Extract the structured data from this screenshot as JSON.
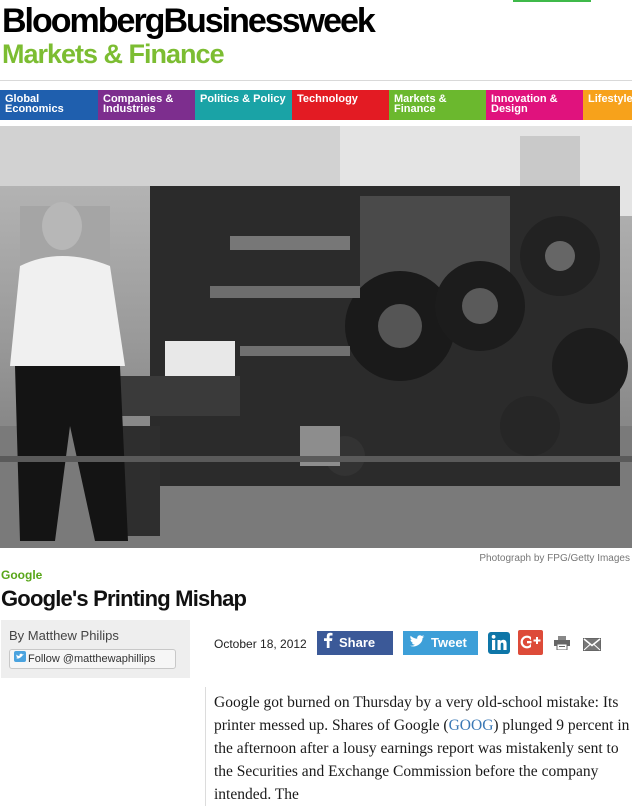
{
  "masthead": {
    "brand": "BloombergBusinessweek",
    "section": "Markets & Finance"
  },
  "nav": {
    "items": [
      {
        "label": "Global Economics",
        "color": "#1f5fae"
      },
      {
        "label": "Companies & Industries",
        "color": "#7d2e8e"
      },
      {
        "label": "Politics & Policy",
        "color": "#1aa3a6"
      },
      {
        "label": "Technology",
        "color": "#e31b23"
      },
      {
        "label": "Markets & Finance",
        "color": "#6bb82e"
      },
      {
        "label": "Innovation & Design",
        "color": "#e0127d"
      },
      {
        "label": "Lifestyle",
        "color": "#f7a21b"
      }
    ]
  },
  "photo": {
    "credit": "Photograph by FPG/Getty Images"
  },
  "article": {
    "kicker": "Google",
    "headline": "Google's Printing Mishap",
    "byline": "By Matthew Philips",
    "follow_label": "Follow @matthewaphillips",
    "date": "October 18, 2012",
    "body_before_ticker": "Google got burned on Thursday by a very old-school mistake: Its printer messed up. Shares of Google (",
    "ticker": "GOOG",
    "body_after_ticker": ") plunged 9 percent in the afternoon after a lousy earnings report was mistakenly sent to the Securities and Exchange Commission before the company intended. The"
  },
  "share": {
    "facebook_label": "Share",
    "twitter_label": "Tweet",
    "icons": [
      "linkedin-icon",
      "google-plus-icon",
      "print-icon",
      "email-icon"
    ]
  }
}
